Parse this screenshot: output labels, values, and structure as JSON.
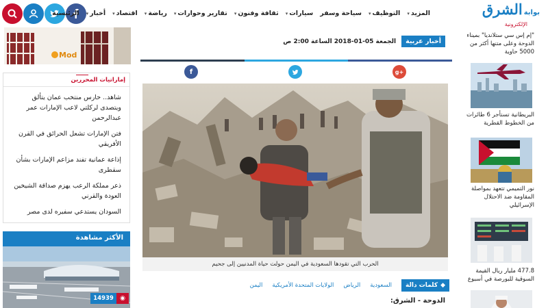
{
  "header": {
    "logo_brand": "الشرق",
    "logo_prefix": "بوابة",
    "logo_sub": "الإلكترونية",
    "nav": [
      {
        "label": "الرئيسية",
        "has_menu": false
      },
      {
        "label": "أخبار",
        "has_menu": true
      },
      {
        "label": "اقتصاد",
        "has_menu": true
      },
      {
        "label": "رياضة",
        "has_menu": true
      },
      {
        "label": "تقارير وحوارات",
        "has_menu": true
      },
      {
        "label": "ثقافة وفنون",
        "has_menu": true
      },
      {
        "label": "سيارات",
        "has_menu": true
      },
      {
        "label": "سياحة وسفر",
        "has_menu": false
      },
      {
        "label": "التوظيف",
        "has_menu": true
      },
      {
        "label": "المزيد",
        "has_menu": true
      }
    ],
    "social_icons": [
      "search-icon",
      "user-icon",
      "twitter-icon",
      "facebook-icon"
    ]
  },
  "left": {
    "ad_text": "Mod",
    "emirates_widget": {
      "title": "إماراتيات المحررين",
      "items": [
        "شاهد.. حارس منتخب عمان يتألق ويتصدى لركلتي لاعب الإمارات عمر عبدالرحمن",
        "فتن الإمارات تشعل الحرائق في القرن الأفريقي",
        "إذاعة عمانية تفند مزاعم الإمارات بشأن سقطرى",
        "ذعر مملكة الرعب يهزم صداقة الشيخين العودة والقرني",
        "السودان يستدعي سفيره لدى مصر"
      ]
    },
    "most_viewed": {
      "title": "الأكثر مشاهدة",
      "views": "14939"
    }
  },
  "article": {
    "category": "أخبار عربية",
    "date": "الجمعة 05-01-2018 الساعة 2:00 ص",
    "caption": "الحرب التي تقودها السعودية في اليمن حولت حياة المدنيين إلى جحيم",
    "keywords_label": "كلمات دالة",
    "tags": [
      "السعودية",
      "الرياض",
      "الولايات المتحدة الأمريكية",
      "اليمن"
    ],
    "dateline": "الدوحة - الشرق:",
    "share": [
      "facebook",
      "twitter",
      "google-plus"
    ],
    "colors": {
      "facebook": "#3b5998",
      "twitter": "#2ca7e0",
      "gplus": "#dd4b39"
    }
  },
  "sidebar": {
    "items": [
      {
        "text": "\"إم إس سي ستلانديا\" بميناء الدوحة وعلى متنها أكثر من 5000 حاوية"
      },
      {
        "text": "البريطانية تستأجر 6 طائرات من الخطوط القطرية"
      },
      {
        "text": "نور التميمي تتعهد بمواصلة المقاومة ضد الاحتلال الإسرائيلي"
      },
      {
        "text": "477.8 مليار ريال القيمة السوقية للبورصة في أسبوع"
      }
    ]
  },
  "colors": {
    "brand_blue": "#1a7fc4",
    "brand_red": "#c8102e"
  }
}
